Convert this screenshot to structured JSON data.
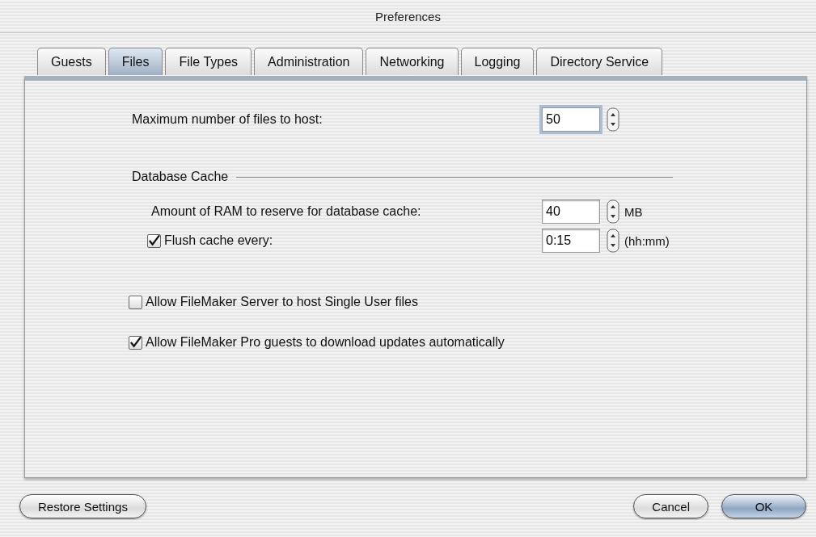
{
  "window": {
    "title": "Preferences"
  },
  "tabs": [
    {
      "label": "Guests",
      "selected": false
    },
    {
      "label": "Files",
      "selected": true
    },
    {
      "label": "File Types",
      "selected": false
    },
    {
      "label": "Administration",
      "selected": false
    },
    {
      "label": "Networking",
      "selected": false
    },
    {
      "label": "Logging",
      "selected": false
    },
    {
      "label": "Directory Service",
      "selected": false
    }
  ],
  "max_files": {
    "label": "Maximum number of files to host:",
    "value": "50",
    "focused": true
  },
  "database_cache": {
    "title": "Database Cache",
    "ram": {
      "label": "Amount of RAM to reserve for database cache:",
      "value": "40",
      "unit": "MB"
    },
    "flush": {
      "label": "Flush cache every:",
      "checked": true,
      "value": "0:15",
      "unit": "(hh:mm)"
    }
  },
  "options": [
    {
      "label": "Allow FileMaker Server to host Single User files",
      "checked": false
    },
    {
      "label": "Allow FileMaker Pro guests to download updates automatically",
      "checked": true
    }
  ],
  "buttons": {
    "left": [
      {
        "label": "Restore Settings",
        "default": false
      }
    ],
    "right": [
      {
        "label": "Cancel",
        "default": false
      },
      {
        "label": "OK",
        "default": true
      }
    ]
  }
}
